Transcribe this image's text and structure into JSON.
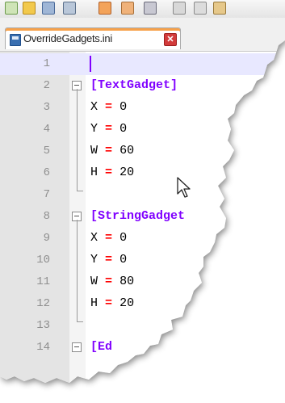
{
  "window": {
    "tab": {
      "title": "OverrideGadgets.ini",
      "close_icon": "close-icon"
    },
    "toolbar_icons": [
      "new-file-icon",
      "open-folder-icon",
      "save-icon",
      "save-all-icon",
      "close-file-icon",
      "close-all-icon",
      "print-icon",
      "cut-icon",
      "copy-icon",
      "paste-icon"
    ]
  },
  "editor": {
    "current_line": 1,
    "lines": [
      {
        "num": "1",
        "text": ""
      },
      {
        "num": "2",
        "text": "[TextGadget]"
      },
      {
        "num": "3",
        "key": "X",
        "eq": "=",
        "value": "0"
      },
      {
        "num": "4",
        "key": "Y",
        "eq": "=",
        "value": "0"
      },
      {
        "num": "5",
        "key": "W",
        "eq": "=",
        "value": "60"
      },
      {
        "num": "6",
        "key": "H",
        "eq": "=",
        "value": "20"
      },
      {
        "num": "7",
        "text": ""
      },
      {
        "num": "8",
        "text": "[StringGadget"
      },
      {
        "num": "9",
        "key": "X",
        "eq": "=",
        "value": "0"
      },
      {
        "num": "10",
        "key": "Y",
        "eq": "=",
        "value": "0"
      },
      {
        "num": "11",
        "key": "W",
        "eq": "=",
        "value": "80"
      },
      {
        "num": "12",
        "key": "H",
        "eq": "=",
        "value": "20"
      },
      {
        "num": "13",
        "text": ""
      },
      {
        "num": "14",
        "text": "[Ed"
      }
    ],
    "colors": {
      "section": "#8000ff",
      "operator": "#ff0000",
      "line_number": "#8f8f8f",
      "current_line_bg": "#e8e8ff"
    }
  }
}
